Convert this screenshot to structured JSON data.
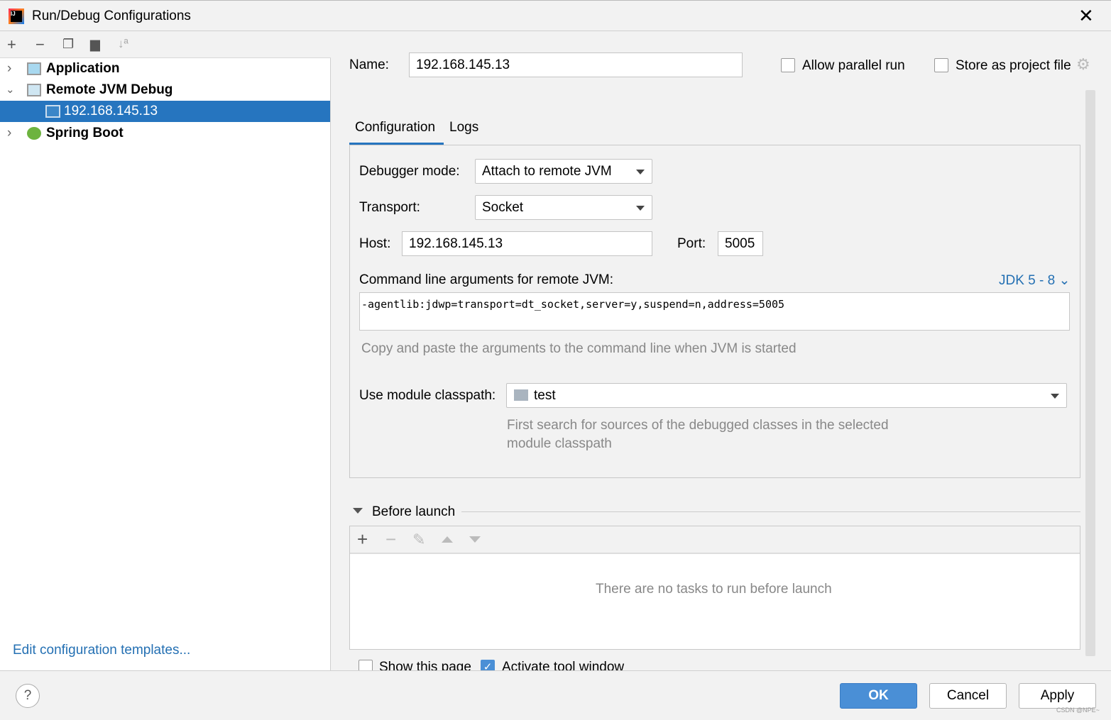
{
  "window": {
    "title": "Run/Debug Configurations"
  },
  "tree": {
    "items": [
      {
        "label": "Application",
        "expanded": false
      },
      {
        "label": "Remote JVM Debug",
        "expanded": true
      },
      {
        "label": "192.168.145.13",
        "selected": true
      },
      {
        "label": "Spring Boot",
        "expanded": false
      }
    ],
    "edit_templates": "Edit configuration templates..."
  },
  "form": {
    "name_label": "Name:",
    "name_value": "192.168.145.13",
    "allow_parallel": "Allow parallel run",
    "allow_parallel_checked": false,
    "store_project": "Store as project file",
    "store_project_checked": false,
    "tabs": [
      "Configuration",
      "Logs"
    ],
    "active_tab": "Configuration",
    "debugger_mode_label": "Debugger mode:",
    "debugger_mode": "Attach to remote JVM",
    "transport_label": "Transport:",
    "transport": "Socket",
    "host_label": "Host:",
    "host": "192.168.145.13",
    "port_label": "Port:",
    "port": "5005",
    "cmd_label": "Command line arguments for remote JVM:",
    "jdk": "JDK 5 - 8",
    "cmd_value": "-agentlib:jdwp=transport=dt_socket,server=y,suspend=n,address=5005",
    "cmd_hint": "Copy and paste the arguments to the command line when JVM is started",
    "module_label": "Use module classpath:",
    "module": "test",
    "module_hint1": "First search for sources of the debugged classes in the selected",
    "module_hint2": "module classpath",
    "before_launch": "Before launch",
    "no_tasks": "There are no tasks to run before launch",
    "show_page": "Show this page",
    "show_page_checked": false,
    "activate_tool": "Activate tool window",
    "activate_tool_checked": true
  },
  "buttons": {
    "ok": "OK",
    "cancel": "Cancel",
    "apply": "Apply",
    "help": "?"
  },
  "watermark": "CSDN @NPE~",
  "colors": {
    "accent": "#2675bf",
    "ok": "#4a8fd6",
    "link": "#2470b3"
  }
}
